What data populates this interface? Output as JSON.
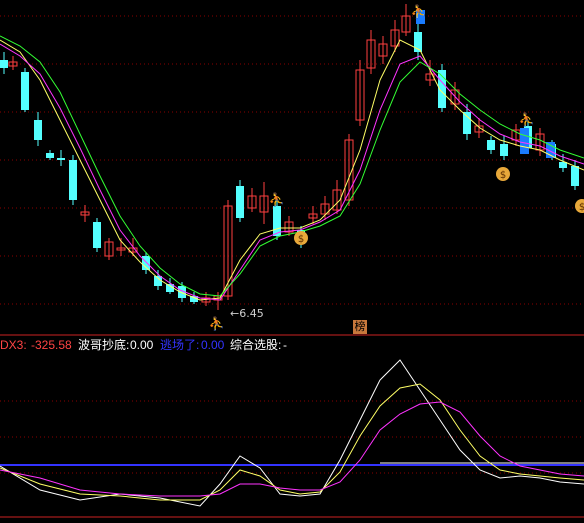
{
  "colors": {
    "background": "#000000",
    "up_candle": "#ff4040",
    "down_candle": "#54ffff",
    "ma_short": "#ffff66",
    "ma_mid": "#ff33ff",
    "ma_long": "#33ff33",
    "grid": "#8a0000",
    "divider": "#cc2222",
    "indicator_blue": "#3333ff",
    "indicator_white": "#ffffff"
  },
  "price_panel": {
    "low_marker_text": "←6.45",
    "badge_text": "榜",
    "candle_icon_name": "person-signal-icon",
    "moneybag_icon_name": "money-bag-icon"
  },
  "indicator_panel": {
    "dx3_label": "DX3:",
    "dx3_value": "-325.58",
    "bottom_label": "波哥抄底:",
    "bottom_value": "0.00",
    "exit_label": "逃场了:",
    "exit_value": "0.00",
    "select_label": "综合选股:",
    "select_value": "-"
  }
}
